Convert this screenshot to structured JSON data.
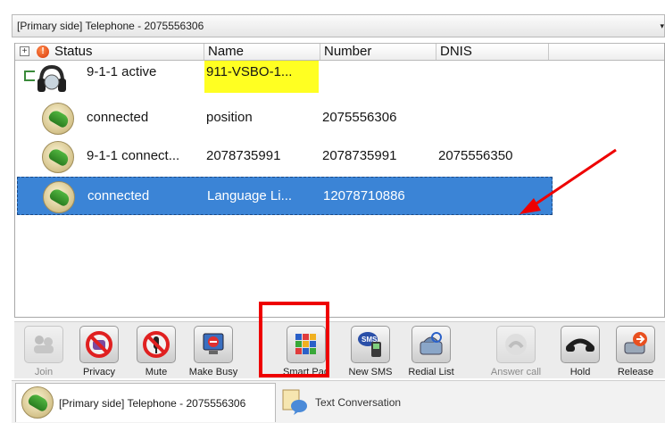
{
  "window": {
    "title": "[Primary side] Telephone - 2075556306"
  },
  "grid": {
    "columns": [
      "Status",
      "Name",
      "Number",
      "DNIS"
    ],
    "rows": [
      {
        "status": "9-1-1 active",
        "name": "911-VSBO-1...",
        "number": "",
        "dnis": "",
        "icon": "headset-icon",
        "highlight": true
      },
      {
        "status": "connected",
        "name": "position",
        "number": "2075556306",
        "dnis": "",
        "icon": "phone-icon"
      },
      {
        "status": "9-1-1 connect...",
        "name": "2078735991",
        "number": "2078735991",
        "dnis": "2075556350",
        "icon": "phone-icon"
      },
      {
        "status": "connected",
        "name": "Language  Li...",
        "number": "12078710886",
        "dnis": "",
        "icon": "phone-icon",
        "selected": true
      }
    ]
  },
  "toolbar": {
    "buttons": [
      {
        "label": "Join",
        "icon": "join-icon",
        "enabled": false
      },
      {
        "label": "Privacy",
        "icon": "privacy-icon",
        "enabled": true
      },
      {
        "label": "Mute",
        "icon": "mute-icon",
        "enabled": true
      },
      {
        "label": "Make Busy",
        "icon": "make-busy-icon",
        "enabled": true
      },
      {
        "label": "Smart Pad",
        "icon": "smart-pad-icon",
        "enabled": true
      },
      {
        "label": "New SMS",
        "icon": "sms-icon",
        "enabled": true
      },
      {
        "label": "Redial List",
        "icon": "redial-icon",
        "enabled": true
      },
      {
        "label": "Answer call",
        "icon": "answer-call-icon",
        "enabled": false
      },
      {
        "label": "Hold",
        "icon": "hold-icon",
        "enabled": true
      },
      {
        "label": "Release",
        "icon": "release-icon",
        "enabled": true
      }
    ]
  },
  "tabs": [
    {
      "label": "[Primary side] Telephone - 2075556306",
      "active": true,
      "icon": "phone-icon"
    },
    {
      "label": "Text Conversation",
      "active": false,
      "icon": "text-conversation-icon"
    }
  ],
  "colors": {
    "selection": "#3b84d6",
    "highlight": "#ffff22",
    "annotation": "#ee0000"
  }
}
